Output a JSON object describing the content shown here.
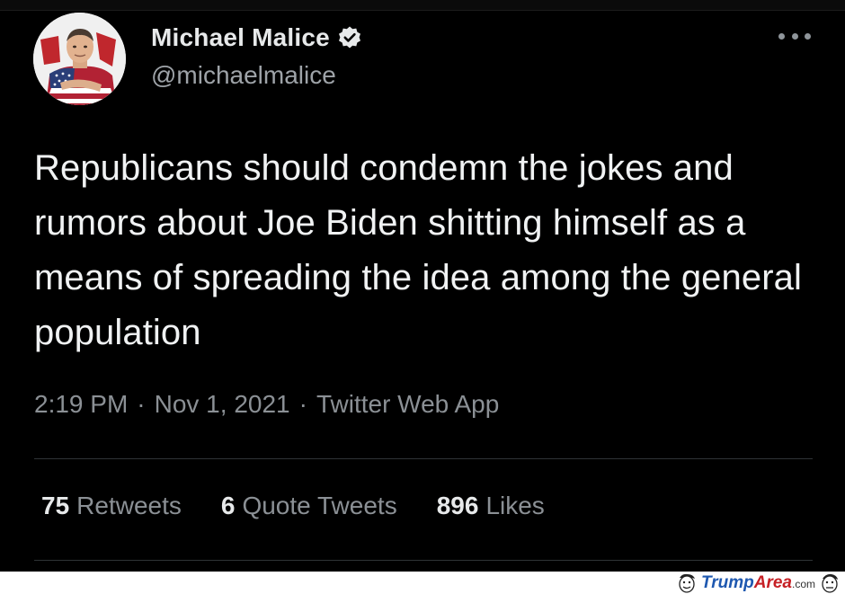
{
  "tweet": {
    "display_name": "Michael Malice",
    "handle": "@michaelmalice",
    "verified": true,
    "text": "Republicans should condemn the jokes and rumors about Joe Biden shitting himself as a means of spreading the idea among the general population",
    "time": "2:19 PM",
    "date": "Nov 1, 2021",
    "source": "Twitter Web App",
    "separator": "·",
    "stats": {
      "retweets_count": "75",
      "retweets_label": "Retweets",
      "quotes_count": "6",
      "quotes_label": "Quote Tweets",
      "likes_count": "896",
      "likes_label": "Likes"
    }
  },
  "watermark": {
    "trump": "Trump",
    "area": "Area",
    "com": ".com"
  },
  "icons": {
    "verified": "verified-badge-icon",
    "more": "more-options-icon",
    "watermark_face": "cartoon-face-icon"
  },
  "colors": {
    "background": "#000000",
    "primary_text": "#e7e9ea",
    "secondary_text": "#8b9095",
    "divider": "#2f3336",
    "watermark_blue": "#1e58b0",
    "watermark_red": "#c62025"
  }
}
